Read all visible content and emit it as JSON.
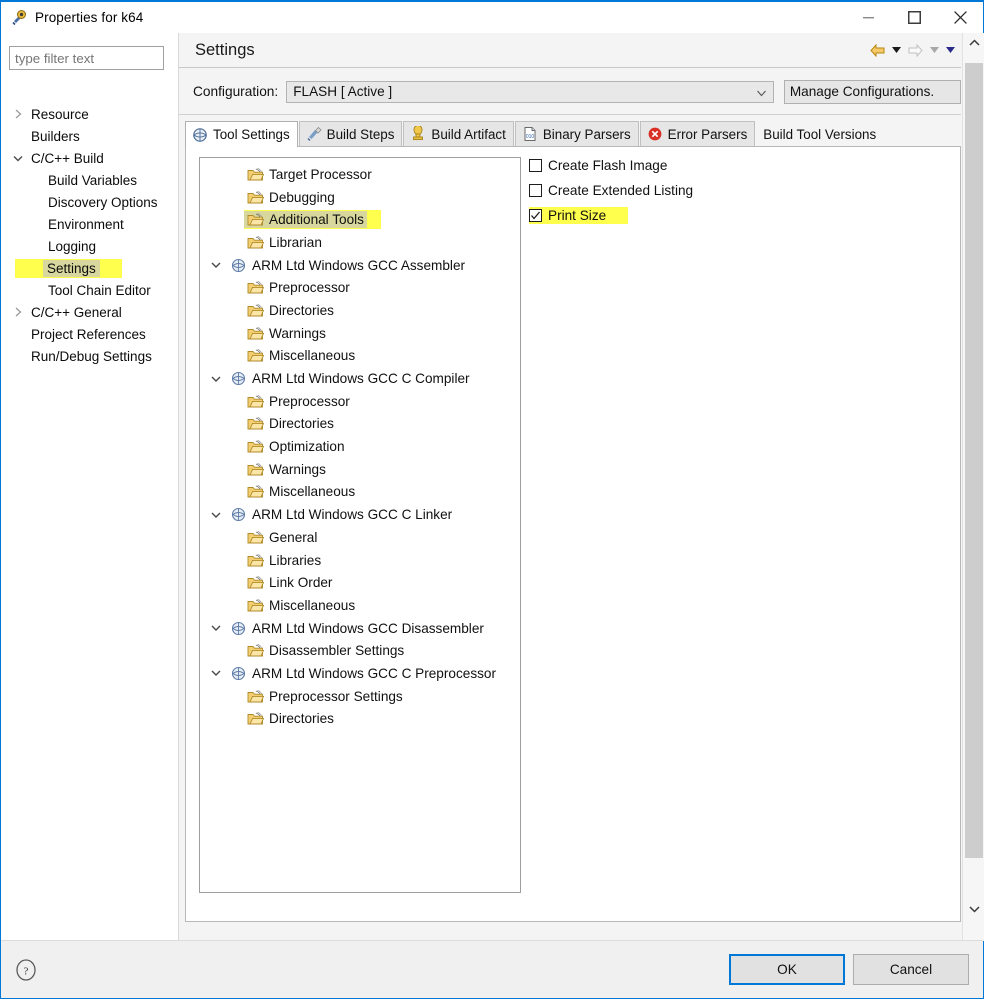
{
  "window": {
    "title": "Properties for k64",
    "icon": "properties-dialog-icon",
    "minimize_label": "Minimize",
    "maximize_label": "Maximize",
    "close_label": "Close"
  },
  "sidebar": {
    "filter": {
      "value": "",
      "placeholder": "type filter text"
    },
    "items": [
      {
        "label": "Resource",
        "level": 0,
        "arrow": "collapsed",
        "highlight": false
      },
      {
        "label": "Builders",
        "level": 0,
        "arrow": "none",
        "highlight": false
      },
      {
        "label": "C/C++ Build",
        "level": 0,
        "arrow": "expanded",
        "highlight": false
      },
      {
        "label": "Build Variables",
        "level": 1,
        "arrow": "none",
        "highlight": false
      },
      {
        "label": "Discovery Options",
        "level": 1,
        "arrow": "none",
        "highlight": false
      },
      {
        "label": "Environment",
        "level": 1,
        "arrow": "none",
        "highlight": false
      },
      {
        "label": "Logging",
        "level": 1,
        "arrow": "none",
        "highlight": false
      },
      {
        "label": "Settings",
        "level": 1,
        "arrow": "none",
        "highlight": true
      },
      {
        "label": "Tool Chain Editor",
        "level": 1,
        "arrow": "none",
        "highlight": false
      },
      {
        "label": "C/C++ General",
        "level": 0,
        "arrow": "collapsed",
        "highlight": false
      },
      {
        "label": "Project References",
        "level": 0,
        "arrow": "none",
        "highlight": false
      },
      {
        "label": "Run/Debug Settings",
        "level": 0,
        "arrow": "none",
        "highlight": false
      }
    ]
  },
  "page": {
    "title": "Settings",
    "nav": {
      "back_icon": "back-arrow-icon",
      "back_menu_icon": "chevron-down-icon",
      "forward_icon": "forward-arrow-icon",
      "forward_menu_icon": "chevron-down-icon",
      "view_menu_icon": "chevron-down-icon"
    }
  },
  "configuration": {
    "label": "Configuration:",
    "value": "FLASH  [ Active ]",
    "dropdown_icon": "chevron-down-icon",
    "manage_button": "Manage Configurations.",
    "manage_expand_icon": "chevron-up-icon"
  },
  "tabs": [
    {
      "label": "Tool Settings",
      "icon": "tool-settings-icon",
      "selected": true
    },
    {
      "label": "Build Steps",
      "icon": "build-steps-icon",
      "selected": false
    },
    {
      "label": "Build Artifact",
      "icon": "build-artifact-icon",
      "selected": false
    },
    {
      "label": "Binary Parsers",
      "icon": "binary-parsers-icon",
      "selected": false
    },
    {
      "label": "Error Parsers",
      "icon": "error-parsers-icon",
      "selected": false
    },
    {
      "label": "Build Tool Versions",
      "icon": "none",
      "selected": false
    }
  ],
  "tool_tree": [
    {
      "label": "Target Processor",
      "level": 1,
      "arrow": "none",
      "icon": "folder-icon",
      "highlight": false
    },
    {
      "label": "Debugging",
      "level": 1,
      "arrow": "none",
      "icon": "folder-icon",
      "highlight": false
    },
    {
      "label": "Additional Tools",
      "level": 1,
      "arrow": "none",
      "icon": "folder-icon",
      "highlight": true
    },
    {
      "label": "Librarian",
      "level": 1,
      "arrow": "none",
      "icon": "folder-icon",
      "highlight": false
    },
    {
      "label": "ARM Ltd Windows GCC Assembler",
      "level": 0,
      "arrow": "expanded",
      "icon": "toolchain-icon",
      "highlight": false
    },
    {
      "label": "Preprocessor",
      "level": 1,
      "arrow": "none",
      "icon": "folder-icon",
      "highlight": false
    },
    {
      "label": "Directories",
      "level": 1,
      "arrow": "none",
      "icon": "folder-icon",
      "highlight": false
    },
    {
      "label": "Warnings",
      "level": 1,
      "arrow": "none",
      "icon": "folder-icon",
      "highlight": false
    },
    {
      "label": "Miscellaneous",
      "level": 1,
      "arrow": "none",
      "icon": "folder-icon",
      "highlight": false
    },
    {
      "label": "ARM Ltd Windows GCC C Compiler",
      "level": 0,
      "arrow": "expanded",
      "icon": "toolchain-icon",
      "highlight": false
    },
    {
      "label": "Preprocessor",
      "level": 1,
      "arrow": "none",
      "icon": "folder-icon",
      "highlight": false
    },
    {
      "label": "Directories",
      "level": 1,
      "arrow": "none",
      "icon": "folder-icon",
      "highlight": false
    },
    {
      "label": "Optimization",
      "level": 1,
      "arrow": "none",
      "icon": "folder-icon",
      "highlight": false
    },
    {
      "label": "Warnings",
      "level": 1,
      "arrow": "none",
      "icon": "folder-icon",
      "highlight": false
    },
    {
      "label": "Miscellaneous",
      "level": 1,
      "arrow": "none",
      "icon": "folder-icon",
      "highlight": false
    },
    {
      "label": "ARM Ltd Windows GCC C Linker",
      "level": 0,
      "arrow": "expanded",
      "icon": "toolchain-icon",
      "highlight": false
    },
    {
      "label": "General",
      "level": 1,
      "arrow": "none",
      "icon": "folder-icon",
      "highlight": false
    },
    {
      "label": "Libraries",
      "level": 1,
      "arrow": "none",
      "icon": "folder-icon",
      "highlight": false
    },
    {
      "label": "Link Order",
      "level": 1,
      "arrow": "none",
      "icon": "folder-icon",
      "highlight": false
    },
    {
      "label": "Miscellaneous",
      "level": 1,
      "arrow": "none",
      "icon": "folder-icon",
      "highlight": false
    },
    {
      "label": "ARM Ltd Windows GCC Disassembler",
      "level": 0,
      "arrow": "expanded",
      "icon": "toolchain-icon",
      "highlight": false
    },
    {
      "label": "Disassembler Settings",
      "level": 1,
      "arrow": "none",
      "icon": "folder-icon",
      "highlight": false
    },
    {
      "label": "ARM Ltd Windows GCC C Preprocessor",
      "level": 0,
      "arrow": "expanded",
      "icon": "toolchain-icon",
      "highlight": false
    },
    {
      "label": "Preprocessor Settings",
      "level": 1,
      "arrow": "none",
      "icon": "folder-icon",
      "highlight": false
    },
    {
      "label": "Directories",
      "level": 1,
      "arrow": "none",
      "icon": "folder-icon",
      "highlight": false
    }
  ],
  "options": [
    {
      "label": "Create Flash Image",
      "checked": false,
      "highlight": false
    },
    {
      "label": "Create Extended Listing",
      "checked": false,
      "highlight": false
    },
    {
      "label": "Print Size",
      "checked": true,
      "highlight": true
    }
  ],
  "footer": {
    "help_icon": "help-icon",
    "ok": "OK",
    "cancel": "Cancel"
  },
  "scrollbars": {
    "h_left_icon": "chevron-left-icon",
    "h_right_icon": "chevron-right-icon",
    "v_up_icon": "chevron-up-icon",
    "v_down_icon": "chevron-down-icon"
  },
  "colors": {
    "highlight_yellow": "#ffff4d",
    "selection_olive": "#d7d79e",
    "accent_blue": "#0078d7",
    "nav_back": "#f0a830",
    "error_red": "#d93025"
  }
}
